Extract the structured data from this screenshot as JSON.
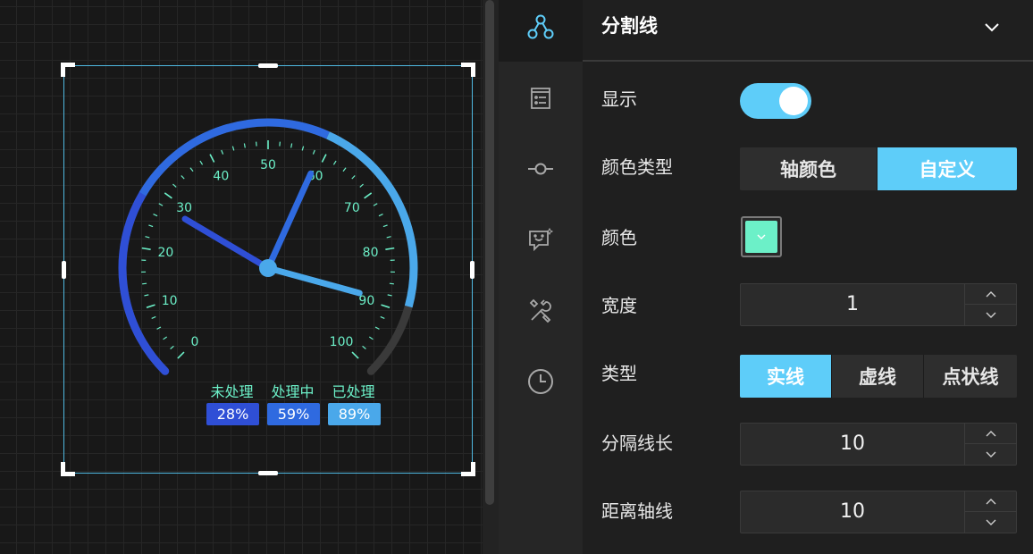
{
  "colors": {
    "accent": "#5ecdf9",
    "split_line": "#6cf0c8",
    "pointer_dark": "#2f4fd6",
    "pointer_mid": "#2f6ae0",
    "pointer_light": "#4aa8ea",
    "track": "#3a3a3a"
  },
  "gauge": {
    "scale_min": 0,
    "scale_max": 100,
    "tick_labels": [
      "0",
      "10",
      "20",
      "30",
      "40",
      "50",
      "60",
      "70",
      "80",
      "90",
      "100"
    ],
    "legend": [
      {
        "name": "未处理",
        "value_label": "28%",
        "value": 28,
        "color": "#2f4fd6"
      },
      {
        "name": "处理中",
        "value_label": "59%",
        "value": 59,
        "color": "#2f6ae0"
      },
      {
        "name": "已处理",
        "value_label": "89%",
        "value": 89,
        "color": "#4aa8ea"
      }
    ]
  },
  "rail": {
    "icons": [
      "network-icon",
      "list-icon",
      "axis-line-icon",
      "tooltip-icon",
      "tools-icon",
      "clock-icon"
    ],
    "active": "network-icon"
  },
  "panel": {
    "title": "分割线",
    "show": {
      "label": "显示",
      "on": true
    },
    "color_type": {
      "label": "颜色类型",
      "options": [
        "轴颜色",
        "自定义"
      ],
      "selected": "自定义"
    },
    "color": {
      "label": "颜色",
      "value": "#6cf0c8"
    },
    "width": {
      "label": "宽度",
      "value": "1"
    },
    "line_type": {
      "label": "类型",
      "options": [
        "实线",
        "虚线",
        "点状线"
      ],
      "selected": "实线"
    },
    "split_length": {
      "label": "分隔线长",
      "value": "10"
    },
    "axis_distance": {
      "label": "距离轴线",
      "value": "10"
    }
  }
}
